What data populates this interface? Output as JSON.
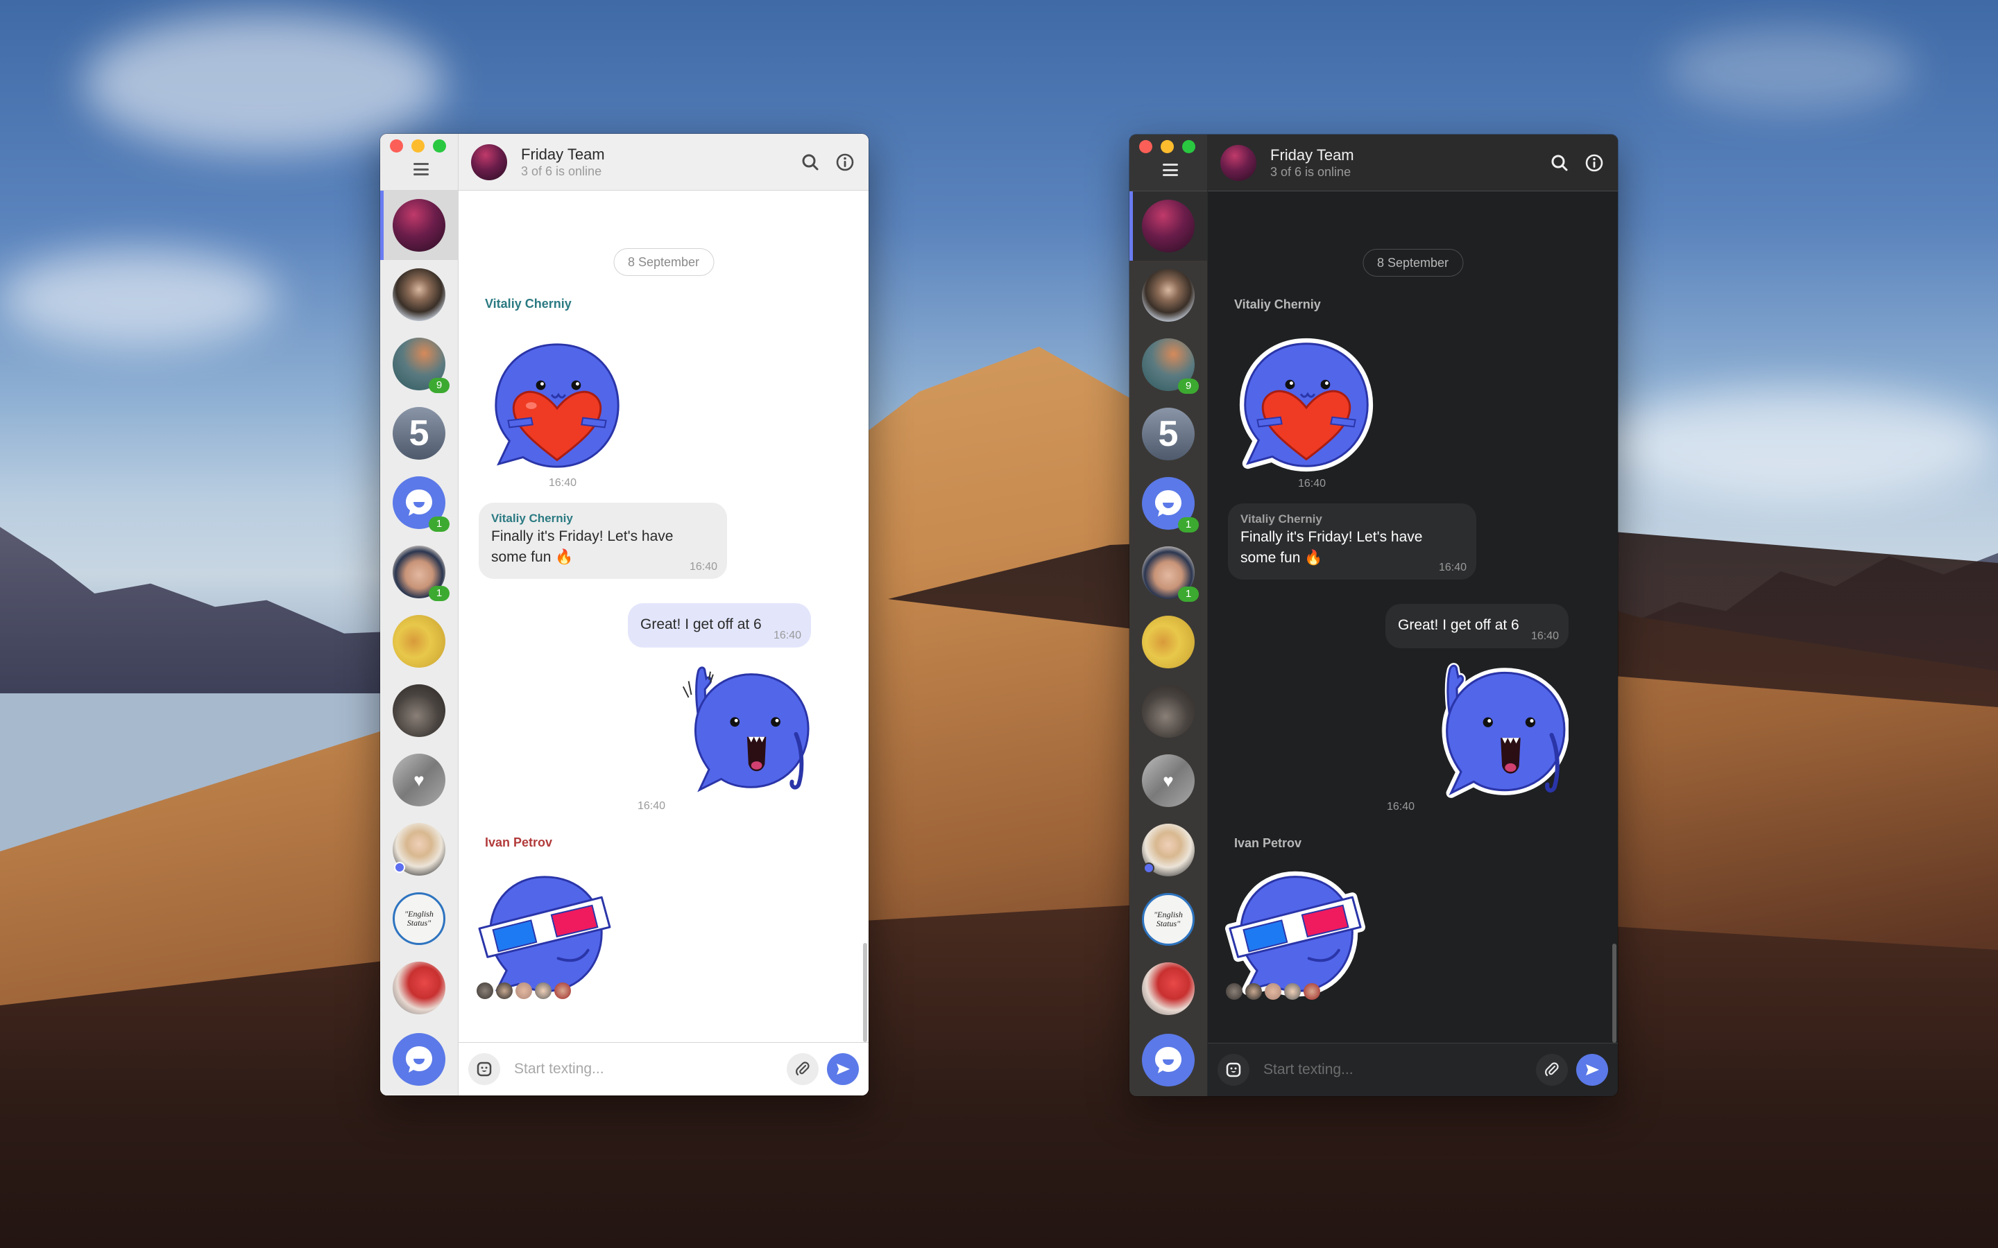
{
  "colors": {
    "accent": "#5b79e8",
    "badge_green": "#3caa30",
    "active_indicator": "#6a7cf2",
    "light_sender_vitaliy": "#2b7a82",
    "light_sender_ivan": "#b23b3b",
    "light_outgoing_bubble": "#e3e6fb",
    "dark_background": "#1e2022"
  },
  "windows": [
    {
      "theme": "light",
      "header": {
        "title": "Friday Team",
        "subtitle": "3 of 6 is online",
        "icons": [
          "search-icon",
          "info-icon"
        ]
      },
      "sidebar": {
        "menu_icon": "hamburger-menu-icon",
        "chats": [
          {
            "name": "Friday Team",
            "active": true,
            "badge": null,
            "online": false
          },
          {
            "name": "Man in shirt",
            "active": false,
            "badge": null,
            "online": false
          },
          {
            "name": "Fantasy art",
            "active": false,
            "badge": "9",
            "online": false
          },
          {
            "name": "5 logo",
            "active": false,
            "badge": null,
            "online": false
          },
          {
            "name": "Chat bot",
            "active": false,
            "badge": "1",
            "online": false
          },
          {
            "name": "Young man",
            "active": false,
            "badge": "1",
            "online": false
          },
          {
            "name": "This is fine dog",
            "active": false,
            "badge": null,
            "online": false
          },
          {
            "name": "Girl photo",
            "active": false,
            "badge": null,
            "online": false
          },
          {
            "name": "Heart key",
            "active": false,
            "badge": null,
            "online": false
          },
          {
            "name": "Blonde woman",
            "active": false,
            "badge": null,
            "online": true
          },
          {
            "name": "English Status",
            "active": false,
            "badge": null,
            "online": false,
            "label": "\"English Status\""
          },
          {
            "name": "Red flower",
            "active": false,
            "badge": null,
            "online": false
          }
        ],
        "app_logo": "chat-logo-icon"
      },
      "messages": {
        "date": "8 September",
        "items": [
          {
            "type": "sticker",
            "sender": "Vitaliy Cherniy",
            "sticker": "heart-hug-sticker",
            "time": "16:40"
          },
          {
            "type": "text",
            "direction": "in",
            "sender": "Vitaliy Cherniy",
            "text": "Finally it's Friday! Let's have some fun 🔥",
            "time": "16:40"
          },
          {
            "type": "text",
            "direction": "out",
            "text": "Great! I get off at 6",
            "time": "16:40"
          },
          {
            "type": "sticker",
            "direction": "out",
            "sticker": "waving-sticker",
            "time": "16:40"
          },
          {
            "type": "sticker",
            "sender": "Ivan Petrov",
            "sticker": "3d-glasses-sticker",
            "read_by_count": 5
          }
        ]
      },
      "composer": {
        "placeholder": "Start texting...",
        "value": "",
        "emoji_icon": "emoji-icon",
        "attach_icon": "paperclip-icon",
        "send_icon": "send-icon"
      }
    },
    {
      "theme": "dark",
      "header": {
        "title": "Friday Team",
        "subtitle": "3 of 6 is online",
        "icons": [
          "search-icon",
          "info-icon"
        ]
      },
      "sidebar": {
        "menu_icon": "hamburger-menu-icon",
        "chats": [
          {
            "name": "Friday Team",
            "active": true,
            "badge": null,
            "online": false
          },
          {
            "name": "Man in shirt",
            "active": false,
            "badge": null,
            "online": false
          },
          {
            "name": "Fantasy art",
            "active": false,
            "badge": "9",
            "online": false
          },
          {
            "name": "5 logo",
            "active": false,
            "badge": null,
            "online": false
          },
          {
            "name": "Chat bot",
            "active": false,
            "badge": "1",
            "online": false
          },
          {
            "name": "Young man",
            "active": false,
            "badge": "1",
            "online": false
          },
          {
            "name": "This is fine dog",
            "active": false,
            "badge": null,
            "online": false
          },
          {
            "name": "Girl photo",
            "active": false,
            "badge": null,
            "online": false
          },
          {
            "name": "Heart key",
            "active": false,
            "badge": null,
            "online": false
          },
          {
            "name": "Blonde woman",
            "active": false,
            "badge": null,
            "online": true
          },
          {
            "name": "English Status",
            "active": false,
            "badge": null,
            "online": false,
            "label": "\"English Status\""
          },
          {
            "name": "Red flower",
            "active": false,
            "badge": null,
            "online": false
          }
        ],
        "app_logo": "chat-logo-icon"
      },
      "messages": {
        "date": "8 September",
        "items": [
          {
            "type": "sticker",
            "sender": "Vitaliy Cherniy",
            "sticker": "heart-hug-sticker",
            "time": "16:40"
          },
          {
            "type": "text",
            "direction": "in",
            "sender": "Vitaliy Cherniy",
            "text": "Finally it's Friday! Let's have some fun 🔥",
            "time": "16:40"
          },
          {
            "type": "text",
            "direction": "out",
            "text": "Great! I get off at 6",
            "time": "16:40"
          },
          {
            "type": "sticker",
            "direction": "out",
            "sticker": "waving-sticker",
            "time": "16:40"
          },
          {
            "type": "sticker",
            "sender": "Ivan Petrov",
            "sticker": "3d-glasses-sticker",
            "read_by_count": 5
          }
        ]
      },
      "composer": {
        "placeholder": "Start texting...",
        "value": "",
        "emoji_icon": "emoji-icon",
        "attach_icon": "paperclip-icon",
        "send_icon": "send-icon"
      }
    }
  ]
}
